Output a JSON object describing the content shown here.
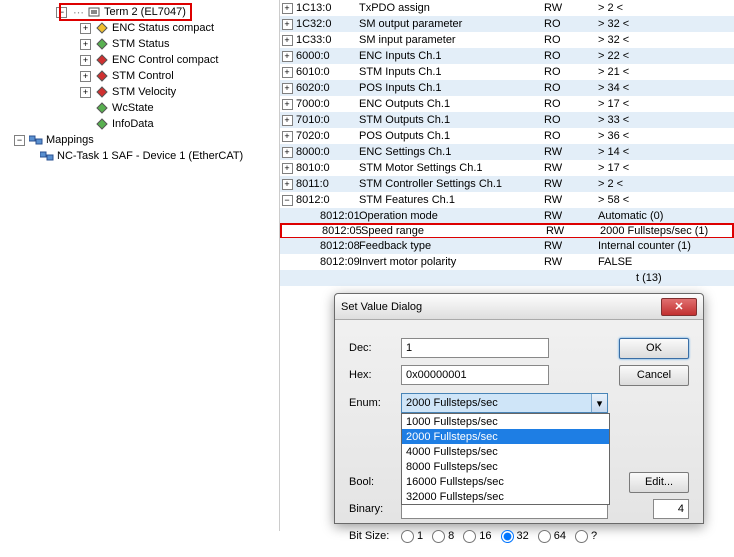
{
  "tree": {
    "term2": "Term 2 (EL7047)",
    "nodes": [
      "ENC Status compact",
      "STM Status",
      "ENC Control compact",
      "STM Control",
      "STM Velocity",
      "WcState",
      "InfoData"
    ],
    "mappings": "Mappings",
    "nc_task": "NC-Task 1 SAF - Device 1 (EtherCAT)"
  },
  "table": {
    "rows": [
      {
        "idx": "1C13:0",
        "name": "TxPDO assign",
        "flag": "RW",
        "val": "> 2 <",
        "alt": false
      },
      {
        "idx": "1C32:0",
        "name": "SM output parameter",
        "flag": "RO",
        "val": "> 32 <",
        "alt": true
      },
      {
        "idx": "1C33:0",
        "name": "SM input parameter",
        "flag": "RO",
        "val": "> 32 <",
        "alt": false
      },
      {
        "idx": "6000:0",
        "name": "ENC Inputs Ch.1",
        "flag": "RO",
        "val": "> 22 <",
        "alt": true
      },
      {
        "idx": "6010:0",
        "name": "STM Inputs Ch.1",
        "flag": "RO",
        "val": "> 21 <",
        "alt": false
      },
      {
        "idx": "6020:0",
        "name": "POS Inputs Ch.1",
        "flag": "RO",
        "val": "> 34 <",
        "alt": true
      },
      {
        "idx": "7000:0",
        "name": "ENC Outputs Ch.1",
        "flag": "RO",
        "val": "> 17 <",
        "alt": false
      },
      {
        "idx": "7010:0",
        "name": "STM Outputs Ch.1",
        "flag": "RO",
        "val": "> 33 <",
        "alt": true
      },
      {
        "idx": "7020:0",
        "name": "POS Outputs Ch.1",
        "flag": "RO",
        "val": "> 36 <",
        "alt": false
      },
      {
        "idx": "8000:0",
        "name": "ENC Settings Ch.1",
        "flag": "RW",
        "val": "> 14 <",
        "alt": true
      },
      {
        "idx": "8010:0",
        "name": "STM Motor Settings Ch.1",
        "flag": "RW",
        "val": "> 17 <",
        "alt": false
      },
      {
        "idx": "8011:0",
        "name": "STM Controller Settings Ch.1",
        "flag": "RW",
        "val": "> 2 <",
        "alt": true
      },
      {
        "idx": "8012:0",
        "name": "STM Features Ch.1",
        "flag": "RW",
        "val": "> 58 <",
        "alt": false
      }
    ],
    "sub": [
      {
        "idx": "8012:01",
        "name": "Operation mode",
        "flag": "RW",
        "val": "Automatic (0)",
        "alt": true
      },
      {
        "idx": "8012:05",
        "name": "Speed range",
        "flag": "RW",
        "val": "2000 Fullsteps/sec (1)",
        "alt": false,
        "hl": true
      },
      {
        "idx": "8012:08",
        "name": "Feedback type",
        "flag": "RW",
        "val": "Internal counter (1)",
        "alt": true
      },
      {
        "idx": "8012:09",
        "name": "Invert motor polarity",
        "flag": "RW",
        "val": "FALSE",
        "alt": false
      }
    ],
    "extra_val": "t (13)"
  },
  "dialog": {
    "title": "Set Value Dialog",
    "dec_lbl": "Dec:",
    "dec_val": "1",
    "hex_lbl": "Hex:",
    "hex_val": "0x00000001",
    "enum_lbl": "Enum:",
    "enum_val": "2000 Fullsteps/sec",
    "bool_lbl": "Bool:",
    "binary_lbl": "Binary:",
    "binary_count": "4",
    "bitsize_lbl": "Bit Size:",
    "ok": "OK",
    "cancel": "Cancel",
    "edit": "Edit...",
    "options": [
      "1000 Fullsteps/sec",
      "2000 Fullsteps/sec",
      "4000 Fullsteps/sec",
      "8000 Fullsteps/sec",
      "16000 Fullsteps/sec",
      "32000 Fullsteps/sec"
    ],
    "bits": [
      "1",
      "8",
      "16",
      "32",
      "64",
      "?"
    ]
  }
}
